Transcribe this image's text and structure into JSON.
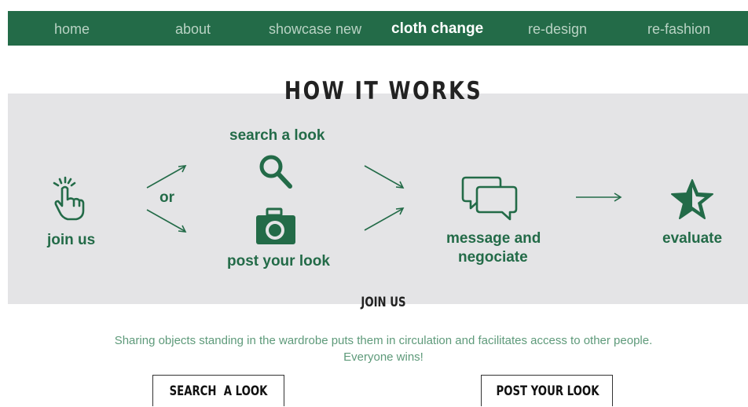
{
  "nav": {
    "items": [
      "home",
      "about",
      "showcase new",
      "cloth change",
      "re-design",
      "re-fashion"
    ],
    "active": "cloth change"
  },
  "how": {
    "title": "HOW IT WORKS",
    "steps": {
      "join": "join us",
      "or": "or",
      "search": "search a look",
      "post": "post your look",
      "message": "message and",
      "message2": "negociate",
      "evaluate": "evaluate"
    },
    "icons": [
      "hand-pointer-icon",
      "search-icon",
      "camera-icon",
      "chat-bubbles-icon",
      "star-icon"
    ]
  },
  "join": {
    "heading": "JOIN US",
    "text_line1": "Sharing objects standing in the wardrobe puts them in circulation and facilitates access to other people.",
    "text_line2": "Everyone wins!",
    "search_button": "SEARCH  A LOOK",
    "post_button": "POST YOUR LOOK"
  },
  "colors": {
    "brand": "#236b48",
    "band": "#e4e4e6",
    "nav_text": "#b9d3c4"
  }
}
